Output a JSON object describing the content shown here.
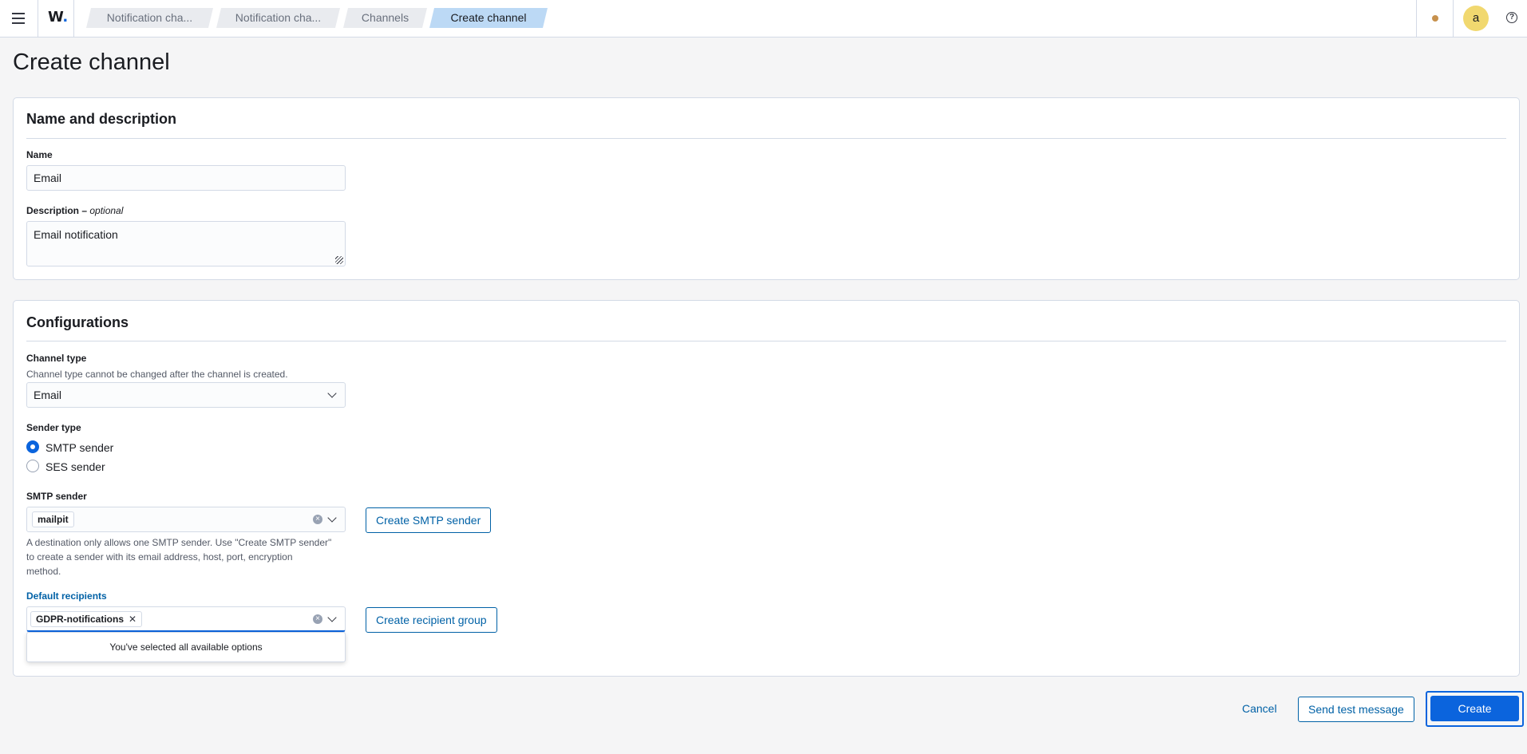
{
  "header": {
    "logo_text": "W",
    "logo_dot": ".",
    "breadcrumbs": [
      "Notification cha...",
      "Notification cha...",
      "Channels",
      "Create channel"
    ],
    "avatar_initial": "a",
    "help_glyph": "?"
  },
  "page": {
    "title": "Create channel"
  },
  "name_section": {
    "title": "Name and description",
    "name_label": "Name",
    "name_value": "Email",
    "description_label": "Description",
    "description_optional": "optional",
    "description_value": "Email notification"
  },
  "config_section": {
    "title": "Configurations",
    "channel_type_label": "Channel type",
    "channel_type_help": "Channel type cannot be changed after the channel is created.",
    "channel_type_value": "Email",
    "sender_type_label": "Sender type",
    "sender_options": [
      {
        "label": "SMTP sender",
        "selected": true
      },
      {
        "label": "SES sender",
        "selected": false
      }
    ],
    "smtp_sender_label": "SMTP sender",
    "smtp_sender_value": "mailpit",
    "smtp_help_line1": "A destination only allows one SMTP sender. Use \"Create SMTP sender\"",
    "smtp_help_line2": "to create a sender with its email address, host, port, encryption",
    "smtp_help_line3": "method.",
    "create_smtp_button": "Create SMTP sender",
    "default_recipients_label": "Default recipients",
    "recipient_chip": "GDPR-notifications",
    "recipient_chip_remove": "✕",
    "dropdown_message": "You've selected all available options",
    "create_recipient_group_button": "Create recipient group"
  },
  "footer": {
    "cancel": "Cancel",
    "send_test": "Send test message",
    "create": "Create"
  },
  "colors": {
    "primary": "#0b64dd",
    "link": "#0061a6",
    "active_breadcrumb": "#bcd9f5",
    "avatar": "#f1d86f"
  }
}
